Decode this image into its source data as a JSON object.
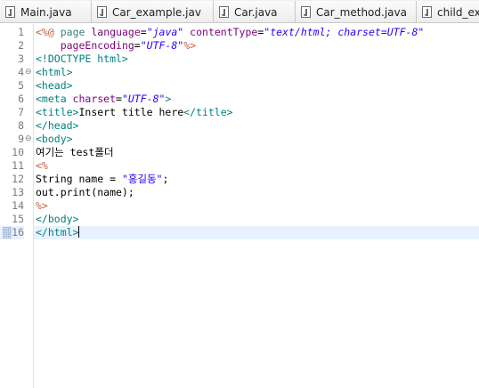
{
  "tabs": [
    {
      "label": "Main.java"
    },
    {
      "label": "Car_example.jav"
    },
    {
      "label": "Car.java"
    },
    {
      "label": "Car_method.java"
    },
    {
      "label": "child_exa"
    }
  ],
  "editor": {
    "current_line": 16,
    "lines": [
      {
        "num": "1",
        "fold": "",
        "parts": [
          [
            "jsp",
            "<%@"
          ],
          [
            "plain",
            " "
          ],
          [
            "dir",
            "page"
          ],
          [
            "plain",
            " "
          ],
          [
            "attr",
            "language"
          ],
          [
            "plain",
            "="
          ],
          [
            "str",
            "\"java\""
          ],
          [
            "plain",
            " "
          ],
          [
            "attr",
            "contentType"
          ],
          [
            "plain",
            "="
          ],
          [
            "str",
            "\"text/html; charset=UTF-8\""
          ]
        ]
      },
      {
        "num": "2",
        "fold": "",
        "parts": [
          [
            "plain",
            "    "
          ],
          [
            "attr",
            "pageEncoding"
          ],
          [
            "plain",
            "="
          ],
          [
            "str",
            "\"UTF-8\""
          ],
          [
            "jsp",
            "%>"
          ]
        ]
      },
      {
        "num": "3",
        "fold": "",
        "parts": [
          [
            "tag",
            "<!DOCTYPE html>"
          ]
        ]
      },
      {
        "num": "4",
        "fold": "⊖",
        "parts": [
          [
            "tag",
            "<html>"
          ]
        ]
      },
      {
        "num": "5",
        "fold": "",
        "parts": [
          [
            "tag",
            "<head>"
          ]
        ]
      },
      {
        "num": "6",
        "fold": "",
        "parts": [
          [
            "tag",
            "<meta "
          ],
          [
            "attr",
            "charset"
          ],
          [
            "plain",
            "="
          ],
          [
            "str",
            "\"UTF-8\""
          ],
          [
            "tag",
            ">"
          ]
        ]
      },
      {
        "num": "7",
        "fold": "",
        "parts": [
          [
            "tag",
            "<title>"
          ],
          [
            "plain",
            "Insert title here"
          ],
          [
            "tag",
            "</title>"
          ]
        ]
      },
      {
        "num": "8",
        "fold": "",
        "parts": [
          [
            "tag",
            "</head>"
          ]
        ]
      },
      {
        "num": "9",
        "fold": "⊖",
        "parts": [
          [
            "tag",
            "<body>"
          ]
        ]
      },
      {
        "num": "10",
        "fold": "",
        "parts": [
          [
            "plain",
            "여기는 test폴더"
          ]
        ]
      },
      {
        "num": "11",
        "fold": "",
        "parts": [
          [
            "jsp",
            "<%"
          ]
        ]
      },
      {
        "num": "12",
        "fold": "",
        "parts": [
          [
            "plain",
            "String name = "
          ],
          [
            "jstr",
            "\"홍길동\""
          ],
          [
            "plain",
            ";"
          ]
        ]
      },
      {
        "num": "13",
        "fold": "",
        "parts": [
          [
            "plain",
            "out.print(name);"
          ]
        ]
      },
      {
        "num": "14",
        "fold": "",
        "parts": [
          [
            "jsp",
            "%>"
          ]
        ]
      },
      {
        "num": "15",
        "fold": "",
        "parts": [
          [
            "tag",
            "</body>"
          ]
        ]
      },
      {
        "num": "16",
        "fold": "",
        "parts": [
          [
            "tag",
            "</html>"
          ]
        ]
      }
    ]
  },
  "colors": {
    "tag": "#008080",
    "attribute": "#7f007f",
    "string": "#2a00ff",
    "jsp_delimiter": "#bf5f3f",
    "current_line_highlight": "#e8f2fe"
  },
  "icons": {
    "tab_icon": "java-file-icon"
  }
}
